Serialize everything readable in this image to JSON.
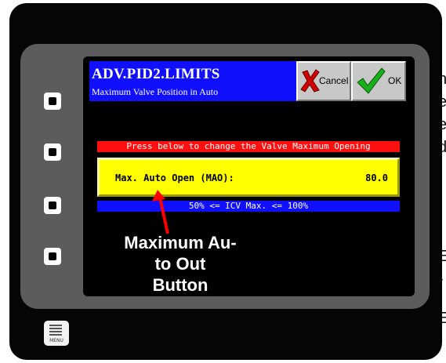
{
  "edge_fragments": {
    "top_right": [
      "n",
      "e",
      "e",
      "d"
    ],
    "bottom_right": [
      "E",
      "-",
      "E"
    ]
  },
  "screen": {
    "title": "ADV.PID2.LIMITS",
    "subtitle": "Maximum Valve Position in Auto",
    "cancel_label": "Cancel",
    "ok_label": "OK",
    "instruction": "Press below to change the Valve Maximum Opening",
    "setting_label": "Max. Auto Open (MAO):",
    "setting_value": "80.0",
    "range_hint": "50% <= ICV Max. <= 100%"
  },
  "annotation": {
    "lines": [
      "Maximum Au-",
      "to Out",
      "Button"
    ],
    "color": "#ff0000"
  },
  "menu_button": {
    "label": "MENU",
    "icon": "menu-icon"
  },
  "colors": {
    "title_bg": "#1010ff",
    "instruction_bg": "#ff1010",
    "setting_bg": "#ffff00",
    "range_bg": "#1010ff",
    "cancel_x": "#d00000",
    "ok_check": "#18b018"
  }
}
